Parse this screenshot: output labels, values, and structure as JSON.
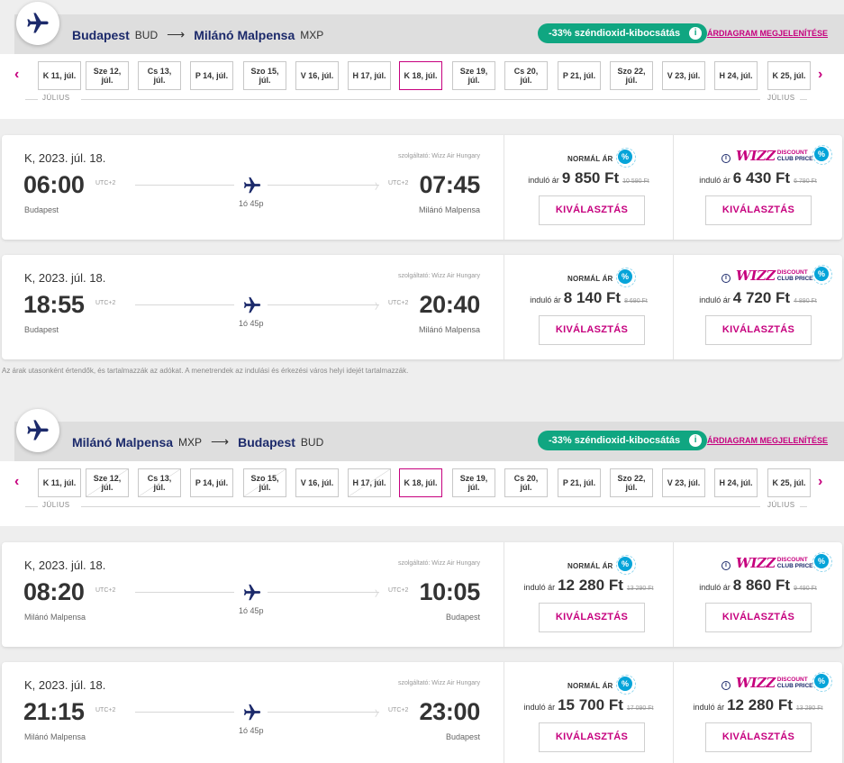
{
  "sections": [
    {
      "from_city": "Budapest",
      "from_code": "BUD",
      "to_city": "Milánó Malpensa",
      "to_code": "MXP",
      "co2_badge": "-33% széndioxid-kibocsátás",
      "chart_link": "ÁRDIAGRAM MEGJELENÍTÉSE",
      "month_left": "JÚLIUS",
      "month_right": "JÚLIUS",
      "dates": [
        {
          "day": "K 11, júl.",
          "crossed": false
        },
        {
          "day": "Sze 12, júl.",
          "crossed": false
        },
        {
          "day": "Cs 13, júl.",
          "crossed": false
        },
        {
          "day": "P 14, júl.",
          "crossed": false
        },
        {
          "day": "Szo 15, júl.",
          "crossed": false
        },
        {
          "day": "V 16, júl.",
          "crossed": false
        },
        {
          "day": "H 17, júl.",
          "crossed": false
        },
        {
          "day": "K 18, júl.",
          "crossed": false,
          "selected": true
        },
        {
          "day": "Sze 19, júl.",
          "crossed": false
        },
        {
          "day": "Cs 20, júl.",
          "crossed": false
        },
        {
          "day": "P 21, júl.",
          "crossed": false
        },
        {
          "day": "Szo 22, júl.",
          "crossed": false
        },
        {
          "day": "V 23, júl.",
          "crossed": false
        },
        {
          "day": "H 24, júl.",
          "crossed": false
        },
        {
          "day": "K 25, júl.",
          "crossed": false
        }
      ],
      "flights": [
        {
          "date": "K, 2023. júl. 18.",
          "dep_time": "06:00",
          "arr_time": "07:45",
          "dep_utc": "UTC+2",
          "arr_utc": "UTC+2",
          "dep_city": "Budapest",
          "arr_city": "Milánó Malpensa",
          "duration": "1ó 45p",
          "operator": "szolgáltató: Wizz Air Hungary",
          "normal_label": "NORMÁL ÁR",
          "from_label": "induló ár",
          "normal_price": "9 850 Ft",
          "normal_old": "10 590 Ft",
          "club_price": "6 430 Ft",
          "club_old": "6 790 Ft",
          "select_label": "KIVÁLASZTÁS"
        },
        {
          "date": "K, 2023. júl. 18.",
          "dep_time": "18:55",
          "arr_time": "20:40",
          "dep_utc": "UTC+2",
          "arr_utc": "UTC+2",
          "dep_city": "Budapest",
          "arr_city": "Milánó Malpensa",
          "duration": "1ó 45p",
          "operator": "szolgáltató: Wizz Air Hungary",
          "normal_label": "NORMÁL ÁR",
          "from_label": "induló ár",
          "normal_price": "8 140 Ft",
          "normal_old": "8 690 Ft",
          "club_price": "4 720 Ft",
          "club_old": "4 890 Ft",
          "select_label": "KIVÁLASZTÁS"
        }
      ]
    },
    {
      "from_city": "Milánó Malpensa",
      "from_code": "MXP",
      "to_city": "Budapest",
      "to_code": "BUD",
      "co2_badge": "-33% széndioxid-kibocsátás",
      "chart_link": "ÁRDIAGRAM MEGJELENÍTÉSE",
      "month_left": "JÚLIUS",
      "month_right": "JÚLIUS",
      "dates": [
        {
          "day": "K 11, júl.",
          "crossed": false
        },
        {
          "day": "Sze 12, júl.",
          "crossed": true
        },
        {
          "day": "Cs 13, júl.",
          "crossed": true
        },
        {
          "day": "P 14, júl.",
          "crossed": false
        },
        {
          "day": "Szo 15, júl.",
          "crossed": true
        },
        {
          "day": "V 16, júl.",
          "crossed": false
        },
        {
          "day": "H 17, júl.",
          "crossed": true
        },
        {
          "day": "K 18, júl.",
          "crossed": false,
          "selected": true
        },
        {
          "day": "Sze 19, júl.",
          "crossed": false
        },
        {
          "day": "Cs 20, júl.",
          "crossed": false
        },
        {
          "day": "P 21, júl.",
          "crossed": false
        },
        {
          "day": "Szo 22, júl.",
          "crossed": false
        },
        {
          "day": "V 23, júl.",
          "crossed": false
        },
        {
          "day": "H 24, júl.",
          "crossed": false
        },
        {
          "day": "K 25, júl.",
          "crossed": false
        }
      ],
      "flights": [
        {
          "date": "K, 2023. júl. 18.",
          "dep_time": "08:20",
          "arr_time": "10:05",
          "dep_utc": "UTC+2",
          "arr_utc": "UTC+2",
          "dep_city": "Milánó Malpensa",
          "arr_city": "Budapest",
          "duration": "1ó 45p",
          "operator": "szolgáltató: Wizz Air Hungary",
          "normal_label": "NORMÁL ÁR",
          "from_label": "induló ár",
          "normal_price": "12 280 Ft",
          "normal_old": "13 290 Ft",
          "club_price": "8 860 Ft",
          "club_old": "9 490 Ft",
          "select_label": "KIVÁLASZTÁS"
        },
        {
          "date": "K, 2023. júl. 18.",
          "dep_time": "21:15",
          "arr_time": "23:00",
          "dep_utc": "UTC+2",
          "arr_utc": "UTC+2",
          "dep_city": "Milánó Malpensa",
          "arr_city": "Budapest",
          "duration": "1ó 45p",
          "operator": "szolgáltató: Wizz Air Hungary",
          "normal_label": "NORMÁL ÁR",
          "from_label": "induló ár",
          "normal_price": "15 700 Ft",
          "normal_old": "17 090 Ft",
          "club_price": "12 280 Ft",
          "club_old": "13 290 Ft",
          "select_label": "KIVÁLASZTÁS"
        }
      ]
    }
  ],
  "club_logo": {
    "wizz": "WIZZ",
    "line1": "DISCOUNT",
    "line2": "CLUB PRICE"
  },
  "disclaimer": "Az árak utasonként értendők, és tartalmazzák az adókat. A menetrendek az indulási és érkezési város helyi idejét tartalmazzák.",
  "colors": {
    "brand": "#c6007e",
    "navy": "#1c2a6b",
    "co2": "#10a681",
    "discount": "#06a4d9"
  },
  "icons": {
    "plane": "airplane-icon",
    "prev": "chevron-left-icon",
    "next": "chevron-right-icon",
    "info": "info-icon",
    "discount": "percent-badge-icon"
  }
}
